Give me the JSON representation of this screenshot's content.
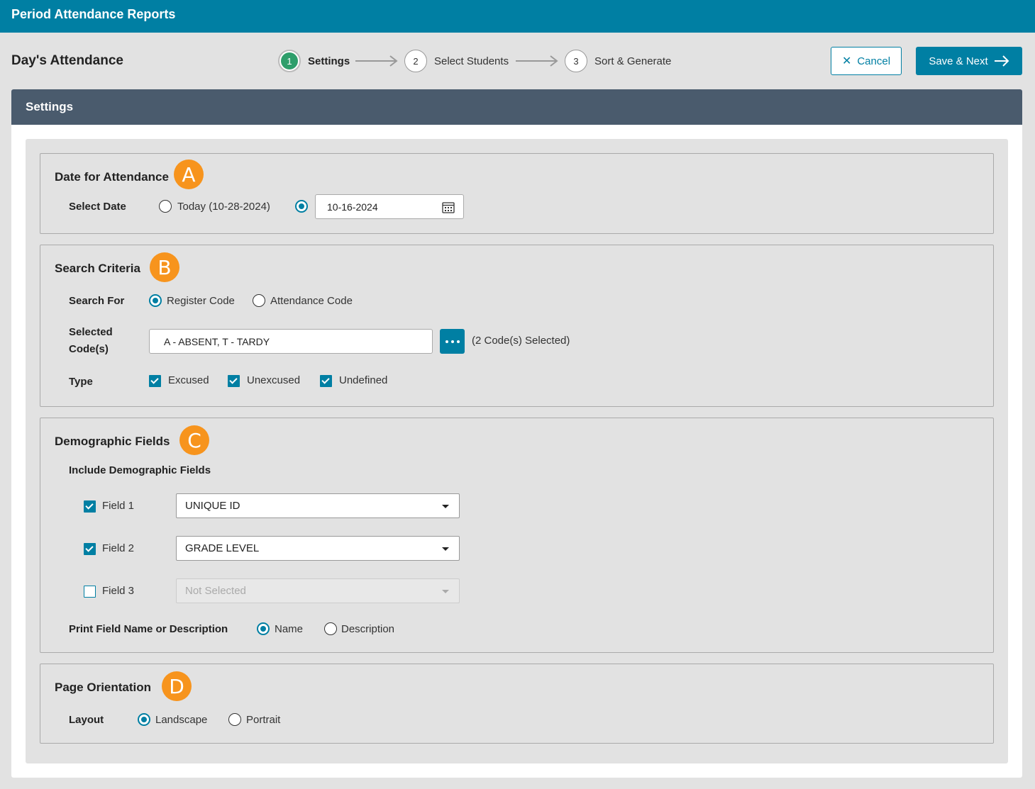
{
  "app": {
    "title": "Period Attendance Reports"
  },
  "page": {
    "title": "Day's Attendance"
  },
  "wizard": {
    "steps": [
      {
        "number": "1",
        "label": "Settings"
      },
      {
        "number": "2",
        "label": "Select Students"
      },
      {
        "number": "3",
        "label": "Sort & Generate"
      }
    ]
  },
  "actions": {
    "cancel_label": "Cancel",
    "save_next_label": "Save & Next"
  },
  "panel": {
    "title": "Settings"
  },
  "date_section": {
    "title": "Date for Attendance",
    "badge": "A",
    "select_date_label": "Select Date",
    "today_option": "Today (10-28-2024)",
    "date_value": "10-16-2024"
  },
  "search_section": {
    "title": "Search Criteria",
    "badge": "B",
    "search_for_label": "Search For",
    "option_register": "Register Code",
    "option_attendance": "Attendance Code",
    "selected_codes_label_1": "Selected",
    "selected_codes_label_2": "Code(s)",
    "selected_codes_value": "A - ABSENT, T - TARDY",
    "selected_count": "(2 Code(s) Selected)",
    "type_label": "Type",
    "types": [
      "Excused",
      "Unexcused",
      "Undefined"
    ]
  },
  "demo_section": {
    "title": "Demographic Fields",
    "badge": "C",
    "include_label": "Include Demographic Fields",
    "fields": [
      {
        "label": "Field 1",
        "value": "UNIQUE ID"
      },
      {
        "label": "Field 2",
        "value": "GRADE LEVEL"
      },
      {
        "label": "Field 3",
        "value": "Not Selected"
      }
    ],
    "print_label": "Print Field Name or Description",
    "option_name": "Name",
    "option_description": "Description"
  },
  "orientation_section": {
    "title": "Page Orientation",
    "badge": "D",
    "layout_label": "Layout",
    "option_landscape": "Landscape",
    "option_portrait": "Portrait"
  },
  "colors": {
    "primary": "#007fa3",
    "header": "#4a5b6d",
    "badge": "#f7941d",
    "step_active": "#2e9e6b"
  }
}
